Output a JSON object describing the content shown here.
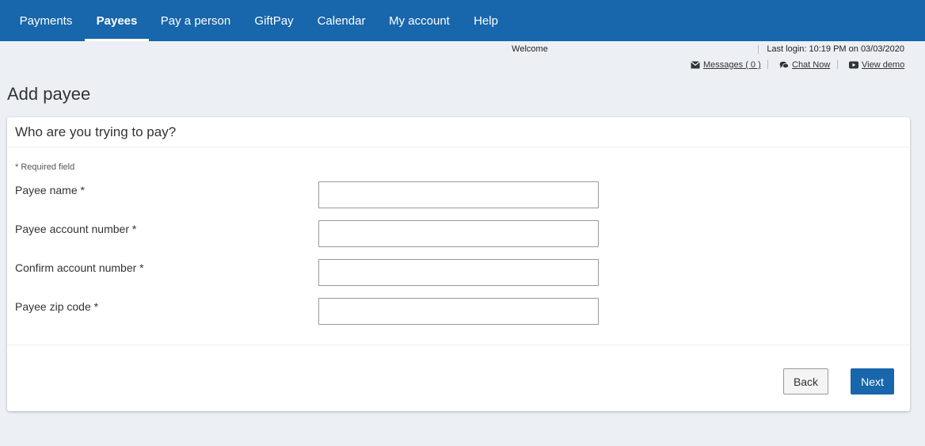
{
  "nav": {
    "items": [
      {
        "label": "Payments"
      },
      {
        "label": "Payees"
      },
      {
        "label": "Pay a person"
      },
      {
        "label": "GiftPay"
      },
      {
        "label": "Calendar"
      },
      {
        "label": "My account"
      },
      {
        "label": "Help"
      }
    ],
    "active": "Payees"
  },
  "header": {
    "welcome": "Welcome",
    "last_login": "Last login: 10:19 PM on 03/03/2020",
    "messages_label": "Messages ( 0 )",
    "chat_label": "Chat Now",
    "demo_label": "View demo",
    "icons": [
      "envelope-icon",
      "chat-icon",
      "video-play-icon"
    ]
  },
  "page": {
    "title": "Add payee"
  },
  "form": {
    "heading": "Who are you trying to pay?",
    "required_note": "* Required field",
    "fields": [
      {
        "label": "Payee name *",
        "value": ""
      },
      {
        "label": "Payee account number *",
        "value": ""
      },
      {
        "label": "Confirm account number *",
        "value": ""
      },
      {
        "label": "Payee zip code *",
        "value": ""
      }
    ],
    "back_label": "Back",
    "next_label": "Next"
  },
  "colors": {
    "brand": "#1866ab",
    "background": "#eceff4"
  }
}
